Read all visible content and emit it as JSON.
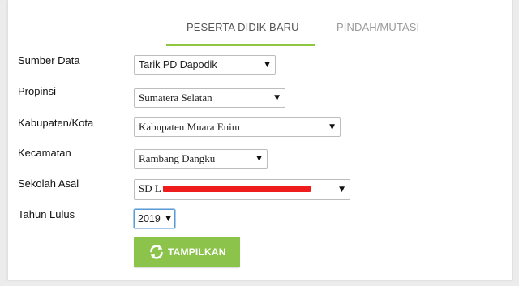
{
  "tabs": [
    {
      "label": "PESERTA DIDIK BARU",
      "active": true
    },
    {
      "label": "PINDAH/MUTASI",
      "active": false
    }
  ],
  "form": {
    "sumber_data": {
      "label": "Sumber Data",
      "value": "Tarik PD Dapodik"
    },
    "propinsi": {
      "label": "Propinsi",
      "value": "Sumatera Selatan"
    },
    "kabupaten": {
      "label": "Kabupaten/Kota",
      "value": "Kabupaten Muara Enim"
    },
    "kecamatan": {
      "label": "Kecamatan",
      "value": "Rambang Dangku"
    },
    "sekolah": {
      "label": "Sekolah Asal",
      "value": "SD L"
    },
    "tahun": {
      "label": "Tahun Lulus",
      "value": "2019"
    }
  },
  "button": {
    "label": "TAMPILKAN",
    "icon": "refresh-icon"
  },
  "colors": {
    "accent": "#8cc34a",
    "redaction": "#ee1c1c"
  }
}
